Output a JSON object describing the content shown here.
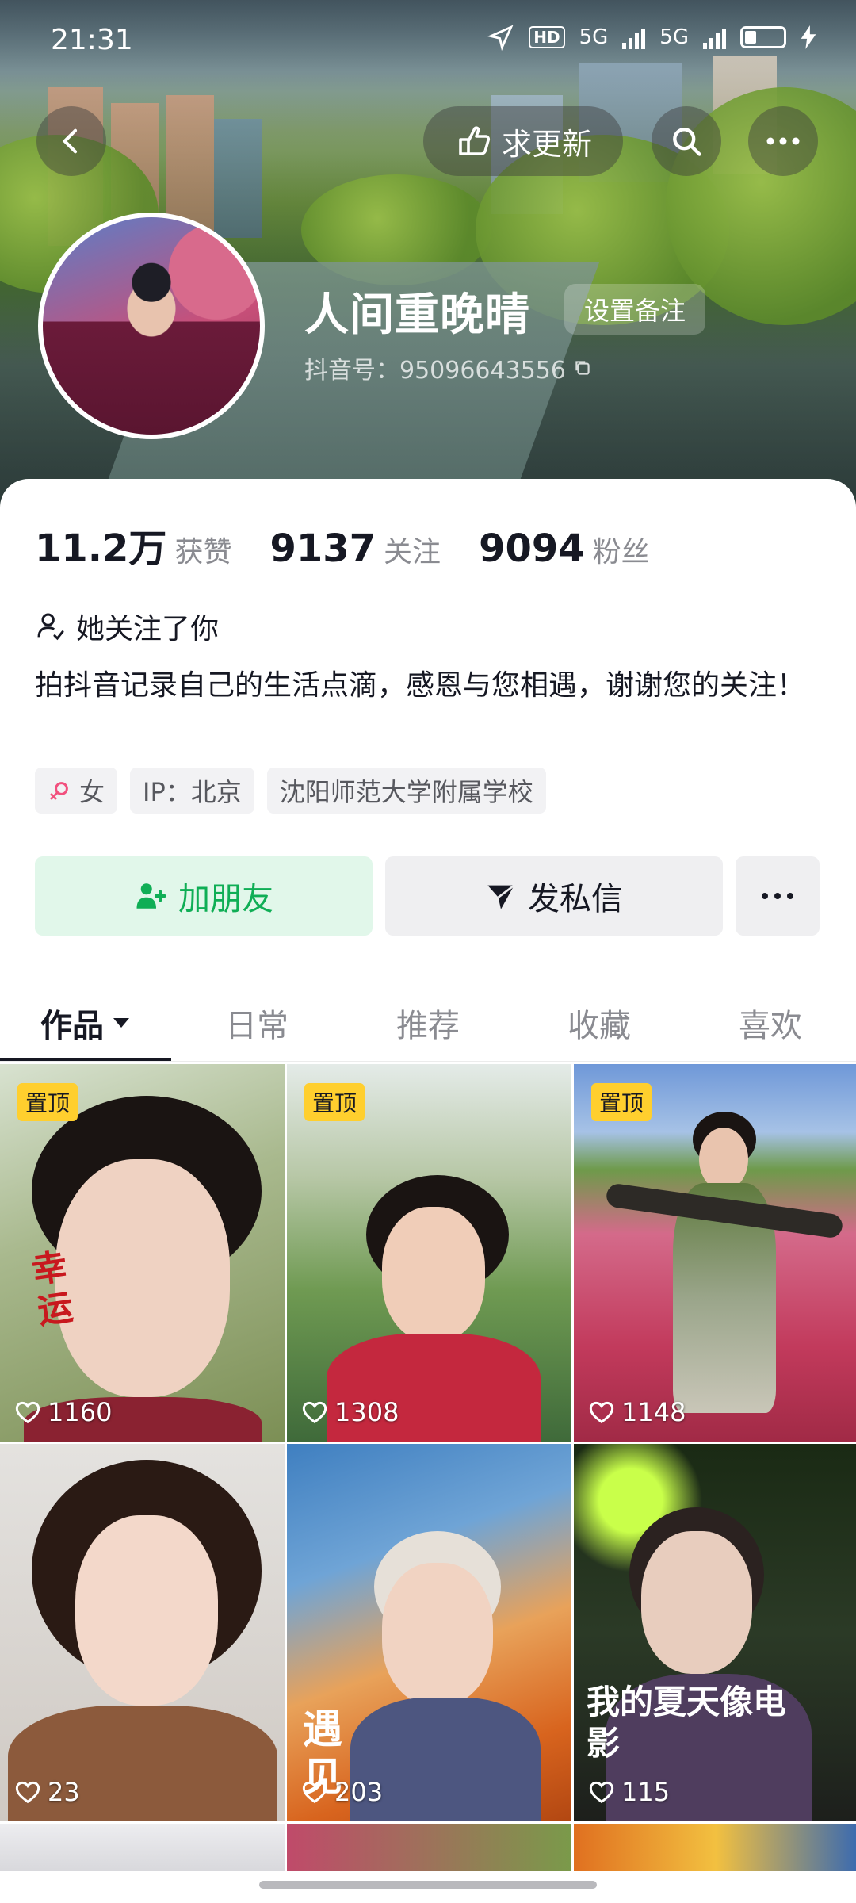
{
  "status_bar": {
    "time": "21:31",
    "hd_label": "HD",
    "net1": "5G",
    "net2": "5G",
    "battery": "3"
  },
  "header": {
    "request_update_label": "求更新",
    "nickname": "人间重晚晴",
    "remark_button": "设置备注",
    "douyin_id": "抖音号：95096643556"
  },
  "stats": [
    {
      "value": "11.2万",
      "label": "获赞"
    },
    {
      "value": "9137",
      "label": "关注"
    },
    {
      "value": "9094",
      "label": "粉丝"
    }
  ],
  "follow_note": "她关注了你",
  "bio": "拍抖音记录自己的生活点滴，感恩与您相遇，谢谢您的关注！",
  "tags": {
    "gender": "女",
    "ip": "IP：北京",
    "school": "沈阳师范大学附属学校"
  },
  "actions": {
    "add_friend": "加朋友",
    "message": "发私信"
  },
  "tabs": [
    "作品",
    "日常",
    "推荐",
    "收藏",
    "喜欢"
  ],
  "videos": [
    {
      "pinned": "置顶",
      "likes": "1160",
      "overlay": "幸运"
    },
    {
      "pinned": "置顶",
      "likes": "1308"
    },
    {
      "pinned": "置顶",
      "likes": "1148"
    },
    {
      "likes": "23"
    },
    {
      "likes": "203",
      "overlay": "遇见"
    },
    {
      "likes": "115",
      "overlay": "我的夏天像电影"
    }
  ],
  "colors": {
    "accent_green": "#0fae55",
    "pin_yellow": "#ffcf2e",
    "text_primary": "#161823",
    "text_secondary": "#8a8b91"
  }
}
